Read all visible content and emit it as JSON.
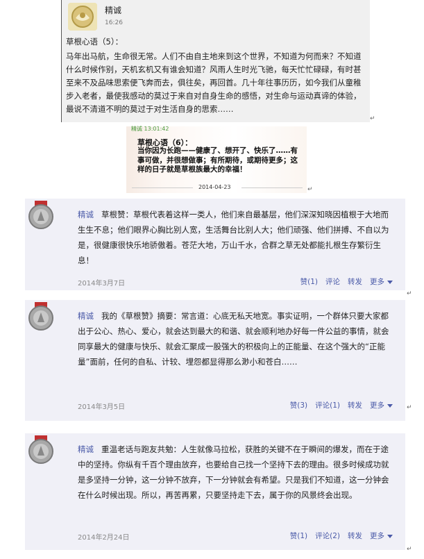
{
  "chat": {
    "name": "精诚",
    "time": "16:26",
    "heading": "草根心语（5）：",
    "body": "马年出马航，生命很无常。人们不由自主地来到这个世界，不知道为何而来？不知道什么时候作别，天机玄机又有谁会知道？风雨人生时光飞驰，每天忙忙碌碌，有时甚至来不及品味思索便飞奔而去，俱往矣，再回首。几十年往事历历，如今我们从童稚步入老者，最使我感动的莫过于来自对自身生命的感悟，对生命与运动真谛的体验，最说不清道不明的莫过于对生活自身的思索……"
  },
  "card": {
    "sender": "精诚 13:01:42",
    "title": "草根心语（6）：",
    "body": "当你因为长跑——健康了、想开了、快乐了……有事可做，并很想做事；有所期待，或期待更多；这样的日子就是草根族最大的幸福！",
    "date": "2014-04-23"
  },
  "posts": [
    {
      "name": "精诚",
      "text": "草根赞：草根代表着这样一类人，他们来自最基层，他们深深知晓因植根于大地而生生不息；他们眼界心胸比别人宽，生活舞台比别人大；他们顽强、他们拼搏、不自以为是，很健康很快乐地骄傲着。苍茫大地，万山千水，合群之草无处都能扎根生存繁衍生息！",
      "date": "2014年3月7日",
      "like": "赞(1)",
      "comment": "评论",
      "forward": "转发",
      "more": "更多"
    },
    {
      "name": "精诚",
      "text": "我的《草根赞》摘要：常言道：心底无私天地宽。事实证明，一个群体只要大家都出于公心、热心、爱心，就会达到最大的和谐、就会顺利地办好每一件公益的事情，就会同享最大的健康与快乐、就会汇聚成一股强大的积极向上的正能量、在这个强大的“正能量”面前，任何的自私、计较、埋怨都显得那么渺小和苍白……",
      "date": "2014年3月5日",
      "like": "赞(3)",
      "comment": "评论(1)",
      "forward": "转发",
      "more": "更多"
    },
    {
      "name": "精诚",
      "text": "重温老话与跑友共勉：人生就像马拉松，获胜的关键不在于瞬间的爆发，而在于途中的坚持。你纵有千百个理由放弃，也要给自己找一个坚持下去的理由。很多时候成功就是多坚持一分钟，这一分钟不放弃，下一分钟就会有希望。只是我们不知道，这一分钟会在什么时候出现。所以，再苦再累，只要坚持走下去，属于你的风景终会出现。",
      "date": "2014年2月24日",
      "like": "赞(1)",
      "comment": "评论(2)",
      "forward": "转发",
      "more": "更多"
    }
  ],
  "icons": {
    "avatar": "medal-avatar-icon",
    "return_mark": "paragraph-return-icon",
    "more": "dropdown-triangle-icon"
  },
  "colors": {
    "link": "#4a5aa8",
    "post_bg": "#f0f0f7",
    "chat_bg": "#f0f0f0",
    "card_sender": "#4a9a3c"
  }
}
